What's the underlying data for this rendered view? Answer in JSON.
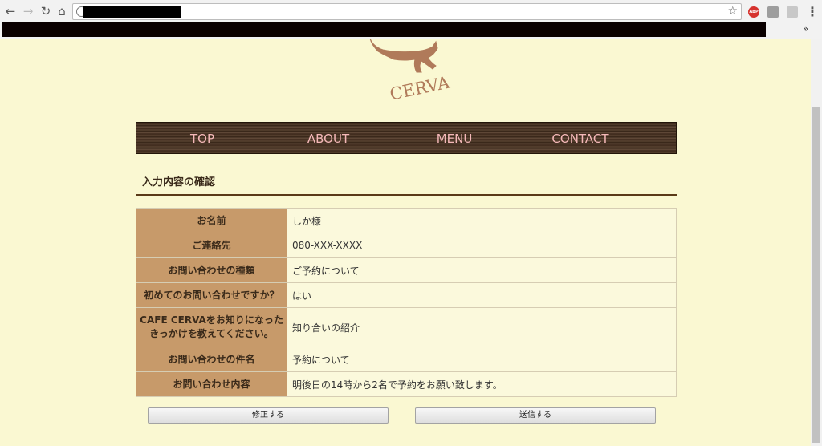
{
  "browser": {
    "nav": {
      "back": "←",
      "forward": "→",
      "reload": "↻",
      "home": "⌂"
    },
    "star": "☆",
    "menu": "⋮",
    "bookmarks_chevron": "»",
    "extensions": [
      {
        "name": "adblock-plus-icon",
        "label": "ABP",
        "color": "#d6332e"
      },
      {
        "name": "extension-icon",
        "color": "#9e9e9e"
      },
      {
        "name": "pdf-extension-icon",
        "color": "#c8c8c8"
      }
    ]
  },
  "site": {
    "logo_text": "CERVA",
    "nav": [
      "TOP",
      "ABOUT",
      "MENU",
      "CONTACT"
    ]
  },
  "page": {
    "heading": "入力内容の確認",
    "rows": [
      {
        "label": "お名前",
        "value": "しか様"
      },
      {
        "label": "ご連絡先",
        "value": "080-XXX-XXXX"
      },
      {
        "label": "お問い合わせの種類",
        "value": "ご予約について"
      },
      {
        "label": "初めてのお問い合わせですか？",
        "value": "はい"
      },
      {
        "label": "CAFE CERVAをお知りになったきっかけを教えてください。",
        "value": "知り合いの紹介"
      },
      {
        "label": "お問い合わせの件名",
        "value": "予約について"
      },
      {
        "label": "お問い合わせ内容",
        "value": "明後日の14時から2名で予約をお願い致します。"
      }
    ],
    "buttons": {
      "edit": "修正する",
      "send": "送信する"
    }
  },
  "colors": {
    "background": "#faf8d2",
    "nav_text": "#f4b8b8",
    "label_bg": "#c79a6a",
    "logo": "#b07a5a"
  }
}
